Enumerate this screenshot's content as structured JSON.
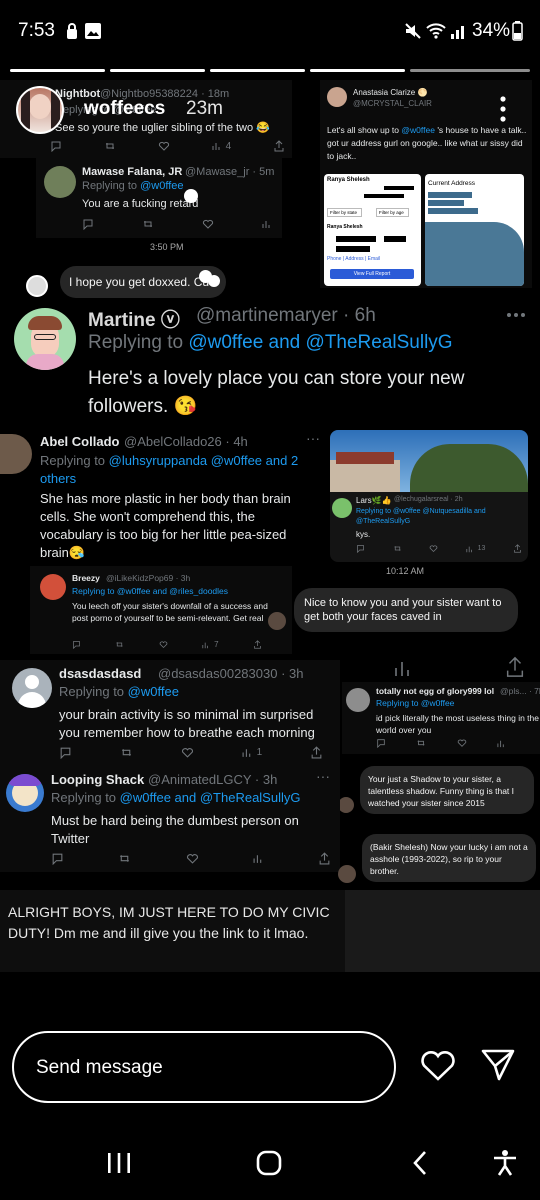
{
  "status_bar": {
    "time": "7:53",
    "battery": "34%"
  },
  "story": {
    "username": "woffeecs",
    "time": "23m"
  },
  "tweets": {
    "nightbot": {
      "name": "Nightbot",
      "handle": "@Nightbo95388224 · 18m",
      "replying": "Replying to @w0ffee",
      "text": "See so youre the uglier sibling of the two 😂",
      "likes": "4"
    },
    "mawase": {
      "name": "Mawase Falana, JR",
      "handle": "@Mawase_jr · 5m",
      "replying_label": "Replying to",
      "replying_handle": "@w0ffee",
      "text": "You are a fucking retard"
    },
    "anastasia": {
      "name": "Anastasia Clarize 🌕",
      "handle": "@MCRYSTAL_CLAIR",
      "text_pre": "Let's all show up to",
      "text_mention": "@w0ffee",
      "text_post": "'s house to have a talk.. got ur address gurl on google.. like what ur sissy did to jack..",
      "doc_name": "Ranya Shelesh",
      "doc_current": "Current Address",
      "doc_filter1": "Filter by state",
      "doc_filter2": "Filter by age",
      "doc_name2": "Ranya Shelesh",
      "doc_links": "Phone | Address | Email",
      "doc_button": "View Full Report"
    },
    "martine": {
      "name": "Martine ⓥ",
      "handle": "@martinemaryer · 6h",
      "replying_label": "Replying to",
      "replying_handles": "@w0ffee and @TheRealSullyG",
      "text": "Here's a lovely place you can store your new followers. 😘"
    },
    "abel": {
      "name": "Abel Collado",
      "handle": "@AbelCollado26 · 4h",
      "replying_label": "Replying to",
      "replying_handles": "@luhsyruppanda @w0ffee and 2 others",
      "text": "She has more plastic in her body than brain cells. She won't comprehend this, the vocabulary is too big for her little pea-sized brain😪"
    },
    "lars": {
      "name": "Lars🌿👍",
      "handle": "@lechugalarsreal · 2h",
      "replying": "Replying to @w0ffee @Nutquesadilla and @TheRealSullyG",
      "text": "kys.",
      "views": "13"
    },
    "breezy": {
      "name": "Breezy",
      "handle": "@iLikeKidzPop69 · 3h",
      "replying": "Replying to @w0ffee and @riles_doodles",
      "text": "You leech off your sister's downfall of a success and post porno of yourself to be semi-relevant. Get real",
      "views": "7"
    },
    "dsas": {
      "name": "dsasdasdasd",
      "handle": "@dsasdas00283030 · 3h",
      "replying_label": "Replying to",
      "replying_handle": "@w0ffee",
      "text": "your brain activity is so minimal im surprised you remember how to breathe each morning",
      "views": "1"
    },
    "egg": {
      "name": "totally not egg of glory999 lol",
      "handle": "@pls... · 7h",
      "replying": "Replying to @w0ffee",
      "text": "id pick literally the most useless thing in the world over you"
    },
    "looping": {
      "name": "Looping Shack",
      "handle": "@AnimatedLGCY · 3h",
      "replying_label": "Replying to",
      "replying_handles": "@w0ffee and @TheRealSullyG",
      "text": "Must be hard being the dumbest person on Twitter"
    }
  },
  "dm": {
    "time1": "3:50 PM",
    "msg1": "I hope you get doxxed. Cu",
    "time2": "10:12 AM",
    "msg2": "Nice to know you and your sister want to get both your faces caved in",
    "msg3": "Your just a Shadow to your sister, a talentless shadow. Funny thing is that I watched your sister since 2015",
    "msg4": "(Bakir Shelesh) Now your lucky i am not a asshole (1993-2022), so rip to your brother."
  },
  "caption": "ALRIGHT BOYS, IM JUST HERE TO DO MY CIVIC DUTY! Dm me and ill give you the link to it lmao.",
  "composer": {
    "placeholder": "Send message"
  }
}
